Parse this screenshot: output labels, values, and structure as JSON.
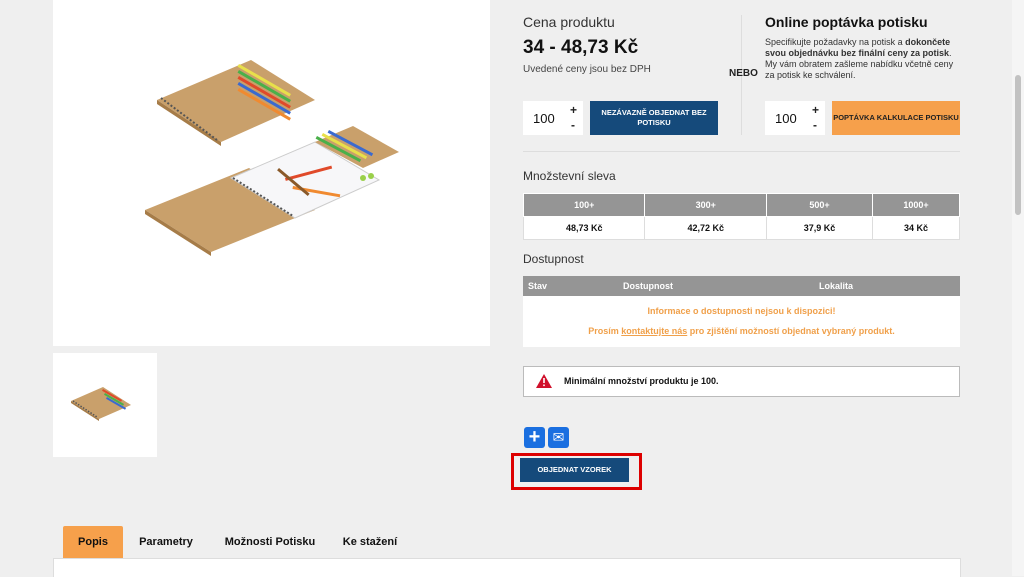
{
  "price": {
    "label": "Cena produktu",
    "value": "34 - 48,73 Kč",
    "note": "Uvedené ceny jsou bez DPH"
  },
  "order": {
    "qty": "100",
    "plus": "+",
    "minus": "-",
    "button": "NEZÁVAZNĚ OBJEDNAT BEZ POTISKU"
  },
  "nebo": "NEBO",
  "inquiry": {
    "title": "Online poptávka potisku",
    "text_pre": "Specifikujte požadavky na potisk a ",
    "text_bold": "dokončete svou objednávku bez finální ceny za potisk",
    "text_post": ". My vám obratem zašleme nabídku včetně ceny za potisk ke schválení.",
    "qty": "100",
    "plus": "+",
    "minus": "-",
    "button": "POPTÁVKA KALKULACE POTISKU"
  },
  "discount": {
    "title": "Množstevní sleva",
    "headers": [
      "100+",
      "300+",
      "500+",
      "1000+"
    ],
    "prices": [
      "48,73 Kč",
      "42,72 Kč",
      "37,9 Kč",
      "34 Kč"
    ]
  },
  "availability": {
    "title": "Dostupnost",
    "headers": [
      "Stav",
      "Dostupnost",
      "Lokalita"
    ],
    "line1": "Informace o dostupnosti nejsou k dispozici!",
    "line2_pre": "Prosím ",
    "line2_link": "kontaktujte nás",
    "line2_post": " pro zjištění možností objednat vybraný produkt."
  },
  "alert": {
    "text": "Minimální množství produktu je 100.",
    "color": "#d0102b"
  },
  "share": {
    "plus": "+",
    "mail": "✉"
  },
  "sample_button": "OBJEDNAT VZOREK",
  "tabs": [
    "Popis",
    "Parametry",
    "Možnosti Potisku",
    "Ke stažení"
  ],
  "colors": {
    "accent_blue": "#154a7b",
    "accent_orange": "#f6a04b",
    "highlight_red": "#d00000"
  }
}
